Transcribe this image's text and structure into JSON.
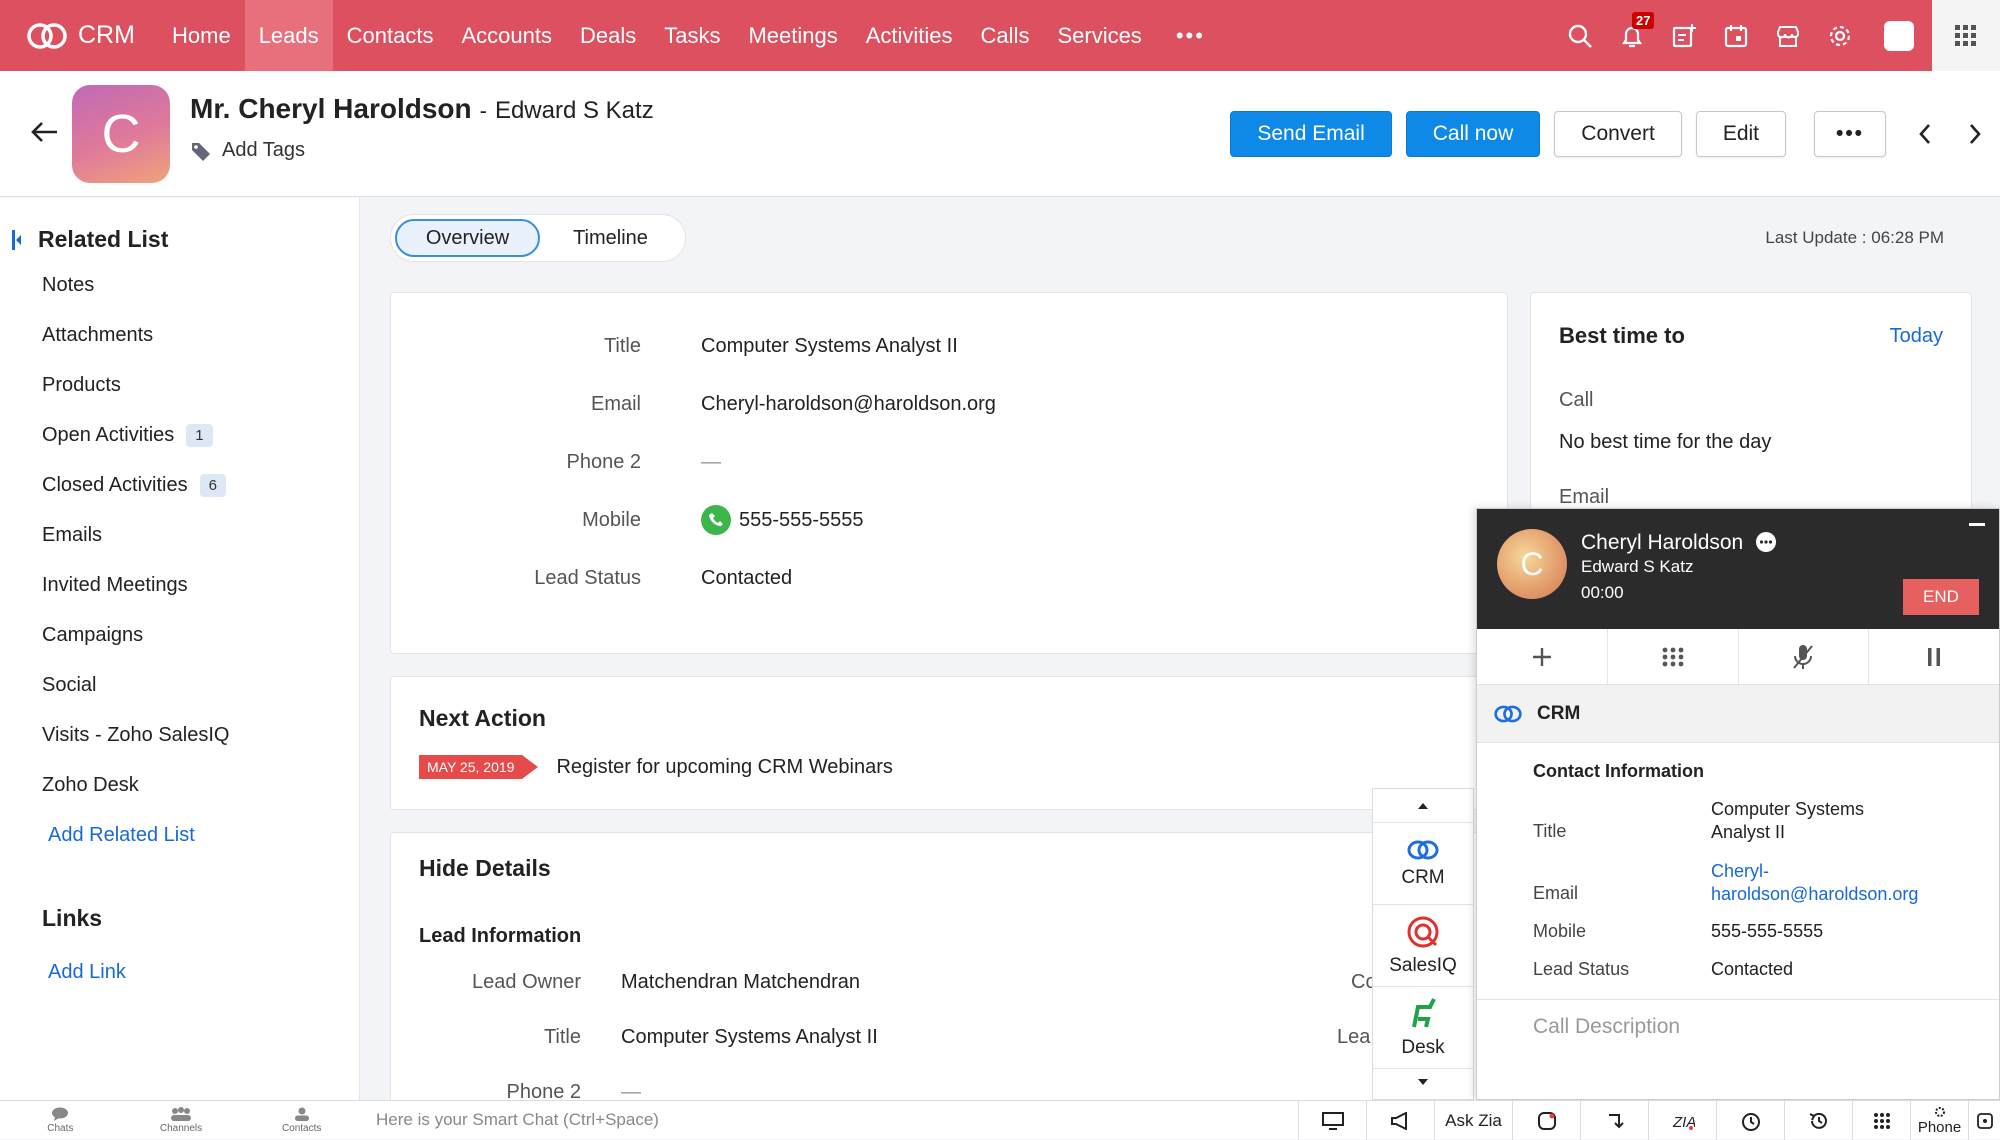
{
  "topnav": {
    "app_name": "CRM",
    "items": [
      "Home",
      "Leads",
      "Contacts",
      "Accounts",
      "Deals",
      "Tasks",
      "Meetings",
      "Activities",
      "Calls",
      "Services"
    ],
    "active": "Leads",
    "more": "•••",
    "notification_count": "27",
    "accent": "#dd5060"
  },
  "header": {
    "name": "Mr. Cheryl Haroldson",
    "separator": "-",
    "company": "Edward S Katz",
    "avatar_letter": "C",
    "add_tags": "Add Tags",
    "buttons": {
      "send_email": "Send Email",
      "call_now": "Call now",
      "convert": "Convert",
      "edit": "Edit",
      "more": "•••"
    }
  },
  "sidebar": {
    "related_title": "Related List",
    "items": [
      {
        "label": "Notes",
        "count": ""
      },
      {
        "label": "Attachments",
        "count": ""
      },
      {
        "label": "Products",
        "count": ""
      },
      {
        "label": "Open Activities",
        "count": "1"
      },
      {
        "label": "Closed Activities",
        "count": "6"
      },
      {
        "label": "Emails",
        "count": ""
      },
      {
        "label": "Invited Meetings",
        "count": ""
      },
      {
        "label": "Campaigns",
        "count": ""
      },
      {
        "label": "Social",
        "count": ""
      },
      {
        "label": "Visits - Zoho SalesIQ",
        "count": ""
      },
      {
        "label": "Zoho Desk",
        "count": ""
      }
    ],
    "add_related": "Add Related List",
    "links_title": "Links",
    "add_link": "Add Link"
  },
  "tabs": {
    "overview": "Overview",
    "timeline": "Timeline",
    "last_update": "Last Update : 06:28 PM"
  },
  "overview": {
    "fields": [
      {
        "label": "Title",
        "value": "Computer Systems Analyst II"
      },
      {
        "label": "Email",
        "value": "Cheryl-haroldson@haroldson.org"
      },
      {
        "label": "Phone 2",
        "value": "—"
      },
      {
        "label": "Mobile",
        "value": "555-555-5555"
      },
      {
        "label": "Lead Status",
        "value": "Contacted"
      }
    ]
  },
  "best_time": {
    "title": "Best time to",
    "today": "Today",
    "call_label": "Call",
    "call_value": "No best time for the day",
    "email_label": "Email"
  },
  "next_action": {
    "title": "Next Action",
    "date": "MAY 25, 2019",
    "text": "Register for upcoming CRM Webinars"
  },
  "details": {
    "title": "Hide Details",
    "section": "Lead Information",
    "fields": [
      {
        "label": "Lead Owner",
        "value": "Matchendran Matchendran"
      },
      {
        "label": "Title",
        "value": "Computer Systems Analyst II"
      },
      {
        "label": "Phone 2",
        "value": "—"
      }
    ],
    "right_partial": [
      "Co",
      "Lea"
    ]
  },
  "dock": {
    "items": [
      "CRM",
      "SalesIQ",
      "Desk"
    ]
  },
  "call": {
    "name": "Cheryl Haroldson",
    "company": "Edward S Katz",
    "timer": "00:00",
    "end": "END",
    "avatar_letter": "C",
    "crm_label": "CRM",
    "contact_title": "Contact Information",
    "fields": {
      "title_label": "Title",
      "title_value_1": "Computer Systems",
      "title_value_2": "Analyst II",
      "email_label": "Email",
      "email_value_1": "Cheryl-",
      "email_value_2": "haroldson@haroldson.org",
      "mobile_label": "Mobile",
      "mobile_value": "555-555-5555",
      "status_label": "Lead Status",
      "status_value": "Contacted"
    },
    "description_placeholder": "Call Description"
  },
  "bottombar": {
    "left": [
      "Chats",
      "Channels",
      "Contacts"
    ],
    "smartchat": "Here is your Smart Chat (Ctrl+Space)",
    "ask_zia": "Ask Zia",
    "phone": "Phone"
  }
}
